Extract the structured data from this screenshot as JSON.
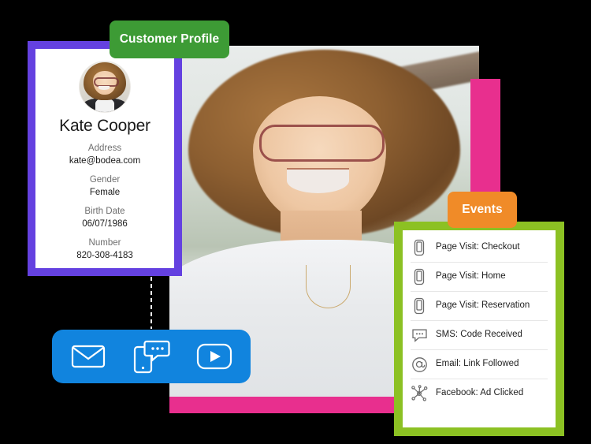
{
  "colors": {
    "badge_profile_bg": "#3d9b35",
    "badge_events_bg": "#f08b28",
    "profile_card_border": "#6441e0",
    "events_card_border": "#8cc123",
    "channel_bar_bg": "#1184de",
    "pink_accent": "#e82f8e"
  },
  "badges": {
    "customer_profile": "Customer Profile",
    "events": "Events"
  },
  "profile": {
    "avatar_icon": "user-avatar-photo",
    "name": "Kate Cooper",
    "fields": [
      {
        "label": "Address",
        "value": "kate@bodea.com"
      },
      {
        "label": "Gender",
        "value": "Female"
      },
      {
        "label": "Birth Date",
        "value": "06/07/1986"
      },
      {
        "label": "Number",
        "value": "820-308-4183"
      }
    ]
  },
  "channel_bar": {
    "items": [
      {
        "icon": "envelope-icon",
        "name": "email-channel"
      },
      {
        "icon": "mobile-chat-icon",
        "name": "sms-channel"
      },
      {
        "icon": "play-video-icon",
        "name": "video-channel"
      }
    ]
  },
  "events": {
    "items": [
      {
        "icon": "mobile-phone-icon",
        "label": "Page Visit: Checkout"
      },
      {
        "icon": "mobile-phone-icon",
        "label": "Page Visit: Home"
      },
      {
        "icon": "mobile-phone-icon",
        "label": "Page Visit: Reservation"
      },
      {
        "icon": "chat-bubble-icon",
        "label": "SMS: Code Received"
      },
      {
        "icon": "at-sign-icon",
        "label": "Email: Link Followed"
      },
      {
        "icon": "share-network-icon",
        "label": "Facebook: Ad Clicked"
      }
    ]
  }
}
